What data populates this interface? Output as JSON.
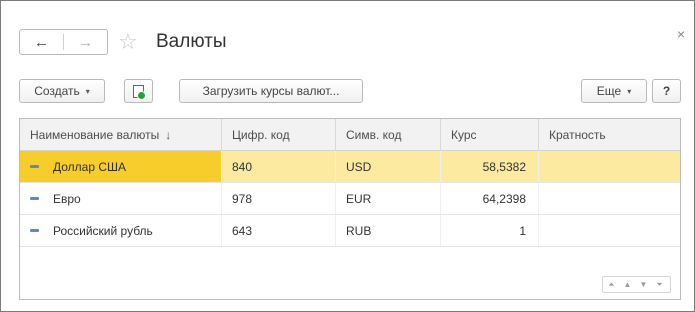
{
  "window": {
    "title": "Валюты",
    "close": "×",
    "nav_back": "←",
    "nav_forward": "→",
    "star": "☆"
  },
  "toolbar": {
    "create_label": "Создать",
    "create_caret": "▾",
    "load_rates_label": "Загрузить курсы валют...",
    "more_label": "Еще",
    "more_caret": "▾",
    "help_label": "?"
  },
  "table": {
    "columns": [
      "Наименование валюты",
      "Цифр. код",
      "Симв. код",
      "Курс",
      "Кратность"
    ],
    "sort_indicator": "↓",
    "rows": [
      {
        "name": "Доллар США",
        "digital_code": "840",
        "symbol_code": "USD",
        "rate": "58,5382",
        "multiplicity": ""
      },
      {
        "name": "Евро",
        "digital_code": "978",
        "symbol_code": "EUR",
        "rate": "64,2398",
        "multiplicity": ""
      },
      {
        "name": "Российский рубль",
        "digital_code": "643",
        "symbol_code": "RUB",
        "rate": "1",
        "multiplicity": ""
      }
    ],
    "selected_row": 0
  },
  "scroll": {
    "first": "⏶",
    "up": "▲",
    "down": "▼",
    "last": "⏷"
  },
  "colors": {
    "selected_row": "#fbeaa0",
    "selected_cell": "#f6cd2a",
    "row_icon": "#5a8ac4"
  }
}
